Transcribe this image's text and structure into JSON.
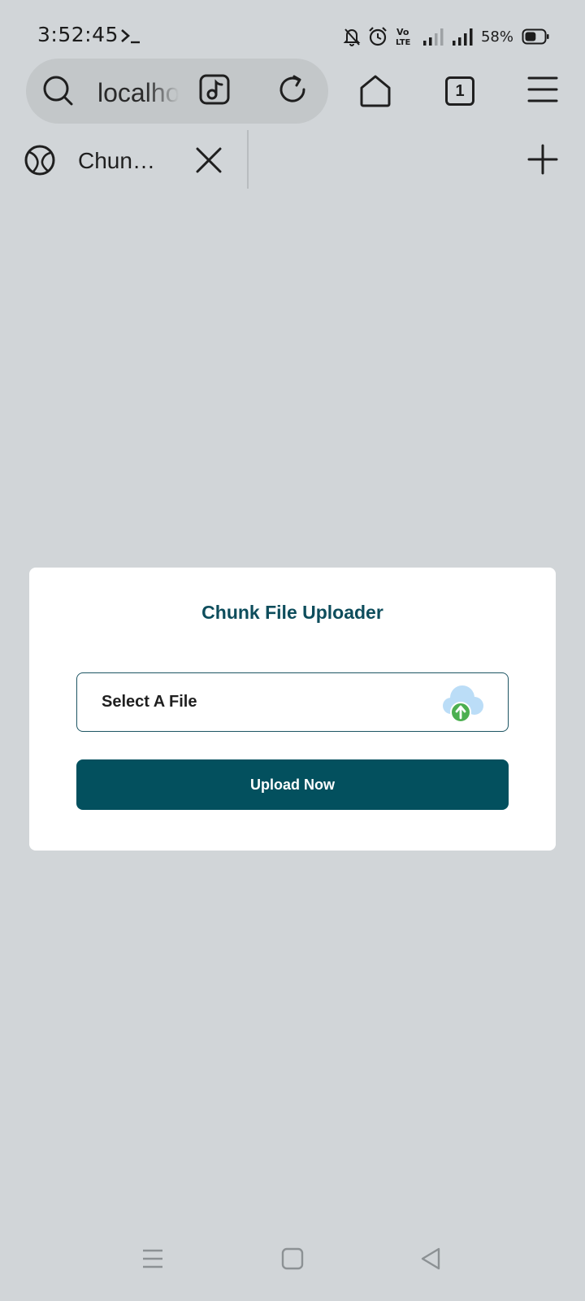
{
  "status_bar": {
    "time": "3:52:45",
    "battery_percent": "58%",
    "battery_level": 0.58,
    "icons": [
      "terminal-icon",
      "bell-off-icon",
      "alarm-icon",
      "volte-icon",
      "signal-icon",
      "signal-icon",
      "battery-icon"
    ]
  },
  "browser": {
    "url": "localhost",
    "tab_count": "1",
    "tab": {
      "title": "Chunk..."
    }
  },
  "uploader": {
    "title": "Chunk File Uploader",
    "select_label": "Select A File",
    "upload_button": "Upload Now"
  },
  "colors": {
    "accent": "#03505E",
    "title": "#0E4D5C",
    "background": "#D1D5D8",
    "card": "#FFFFFF",
    "upload_badge": "#4CAF50",
    "cloud": "#BBDDF7"
  }
}
